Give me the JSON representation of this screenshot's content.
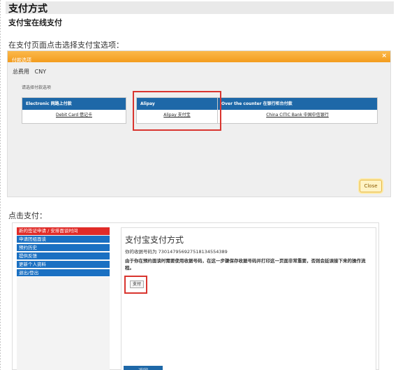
{
  "page": {
    "title": "支付方式",
    "subtitle": "支付宝在线支付",
    "instruction_1": "在支付页面点击选择支付宝选项：",
    "instruction_2": "点击支付："
  },
  "dialog": {
    "header": "付款选项",
    "close_x": "×",
    "fee_label": "总费用",
    "currency": "CNY",
    "choose_label": "请选择付款选项",
    "options": [
      {
        "header": "Electronic 网路上付款",
        "link": "Debit Card 借记卡"
      },
      {
        "header": "Alipay",
        "link": "Alipay 支付宝"
      },
      {
        "header": "Over the counter 在银行柜台付款",
        "link": "China CITIC Bank 中国中信银行"
      }
    ],
    "close_button": "Close"
  },
  "payment_page": {
    "menu": [
      "新的签证申请 / 安排面谈时间",
      "申请团组面谈",
      "预约历史",
      "提供反馈",
      "更新个人资料",
      "退出/登出"
    ],
    "heading": "支付宝支付方式",
    "receipt": "你的收据号码为 730147956927518134554389",
    "note": "由于你在预约面谈时需要使用收据号码，在这一步骤保存收据号码并打印这一页面非常重要，否则会延误接下来的操作流程。",
    "pay_button": "支付",
    "back_button": "返回"
  },
  "colors": {
    "accent_orange": "#f39c1e",
    "nav_blue": "#1e68a8",
    "highlight_red": "#d9352f"
  }
}
